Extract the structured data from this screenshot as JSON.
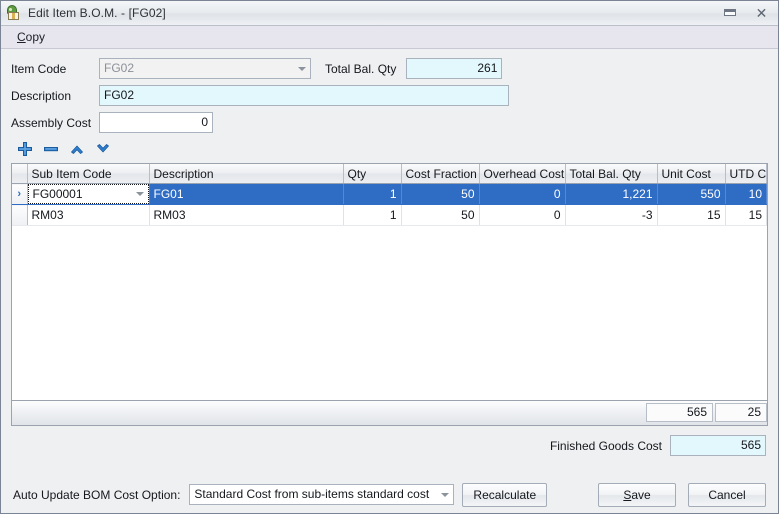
{
  "window": {
    "title": "Edit Item B.O.M. - [FG02]",
    "icon": "bom-item-icon",
    "minimize_label": "",
    "close_label": "✕"
  },
  "menubar": {
    "items": [
      {
        "label": "Copy",
        "accel": "C"
      }
    ]
  },
  "form": {
    "item_code": {
      "label": "Item Code",
      "value": "FG02",
      "readonly": true
    },
    "total_bal_qty": {
      "label": "Total Bal. Qty",
      "value": "261"
    },
    "description": {
      "label": "Description",
      "value": "FG02"
    },
    "assembly_cost": {
      "label": "Assembly Cost",
      "value": "0"
    }
  },
  "grid_toolbar": {
    "buttons": [
      {
        "name": "add-row-button",
        "icon": "plus-icon"
      },
      {
        "name": "remove-row-button",
        "icon": "minus-icon"
      },
      {
        "name": "move-up-button",
        "icon": "chevron-up-icon"
      },
      {
        "name": "move-down-button",
        "icon": "chevron-down-icon"
      }
    ]
  },
  "grid": {
    "columns": [
      "Sub Item Code",
      "Description",
      "Qty",
      "Cost Fraction",
      "Overhead Cost",
      "Total Bal. Qty",
      "Unit Cost",
      "UTD Cost"
    ],
    "rows": [
      {
        "indicator": "›",
        "selected": true,
        "editing": true,
        "sub_item_code": "FG00001",
        "description": "FG01",
        "qty": "1",
        "cost_fraction": "50",
        "overhead_cost": "0",
        "total_bal_qty": "1,221",
        "unit_cost": "550",
        "utd_cost": "10"
      },
      {
        "indicator": "",
        "selected": false,
        "editing": false,
        "sub_item_code": "RM03",
        "description": "RM03",
        "qty": "1",
        "cost_fraction": "50",
        "overhead_cost": "0",
        "total_bal_qty": "-3",
        "unit_cost": "15",
        "utd_cost": "15"
      }
    ],
    "footer": {
      "unit_cost_total": "565",
      "utd_cost_total": "25"
    }
  },
  "finished_goods": {
    "label": "Finished Goods Cost",
    "value": "565"
  },
  "bottom": {
    "auto_update_label": "Auto Update BOM Cost Option:",
    "auto_update_value": "Standard Cost from sub-items standard cost",
    "recalculate_label": "Recalculate",
    "save_label": "Save",
    "save_accel": "S",
    "cancel_label": "Cancel"
  },
  "colors": {
    "selection_blue": "#2f6cc4",
    "field_cyan": "#e3f8fc",
    "cell_yellow": "#fdf7d9",
    "window_bg": "#eff0f2"
  }
}
